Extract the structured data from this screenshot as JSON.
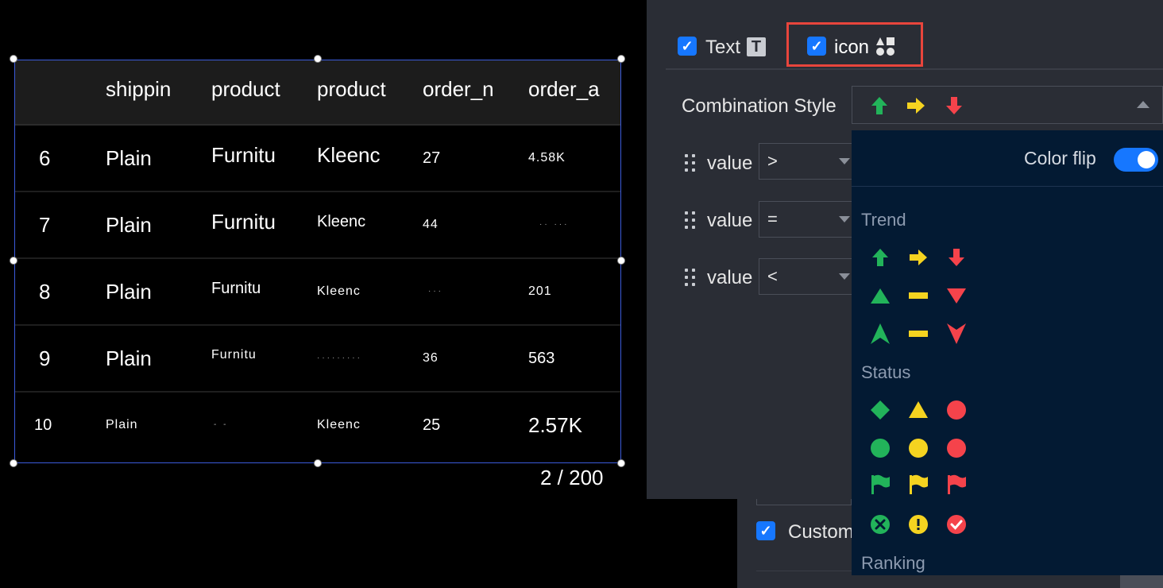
{
  "table": {
    "headers": [
      "",
      "shippin",
      "product",
      "product",
      "order_n",
      "order_a"
    ],
    "rows": [
      [
        "6",
        "Plain",
        "Furnitu",
        "Kleenc",
        "27",
        "4.58K"
      ],
      [
        "7",
        "Plain",
        "Furnitu",
        "Kleenc",
        "44",
        "·· ···"
      ],
      [
        "8",
        "Plain",
        "Furnitu",
        "Kleenc",
        "···",
        "201"
      ],
      [
        "9",
        "Plain",
        "Furnitu",
        "·········",
        "36",
        "563"
      ],
      [
        "10",
        "Plain",
        "-    -",
        "Kleenc",
        "25",
        "2.57K"
      ]
    ],
    "pager": "2 / 200"
  },
  "panel": {
    "tab_text": "Text",
    "tab_icon": "icon",
    "combination_label": "Combination Style",
    "combination_icons": [
      "arrow-up-green",
      "arrow-right-yellow",
      "arrow-down-red"
    ],
    "rules": [
      {
        "field": "value",
        "op": ">"
      },
      {
        "field": "value",
        "op": "="
      },
      {
        "field": "value",
        "op": "<"
      }
    ],
    "custom_label": "Custom",
    "colors": {
      "green": "#22b35a",
      "yellow": "#f5d320",
      "red": "#f5434b",
      "accent": "#1677ff"
    }
  },
  "dropdown": {
    "color_flip_label": "Color flip",
    "color_flip_on": true,
    "groups": [
      {
        "name": "Trend",
        "rows": [
          [
            "arrow-up",
            "arrow-right",
            "arrow-down"
          ],
          [
            "triangle-up",
            "dash",
            "triangle-down"
          ],
          [
            "chevron-up",
            "dash",
            "chevron-down"
          ]
        ]
      },
      {
        "name": "Status",
        "rows": [
          [
            "diamond",
            "triangle",
            "circle"
          ],
          [
            "circle",
            "circle",
            "circle"
          ],
          [
            "flag",
            "flag",
            "flag"
          ],
          [
            "x-circle",
            "exclamation-circle",
            "check-circle"
          ]
        ]
      },
      {
        "name": "Ranking",
        "rows": []
      }
    ]
  }
}
